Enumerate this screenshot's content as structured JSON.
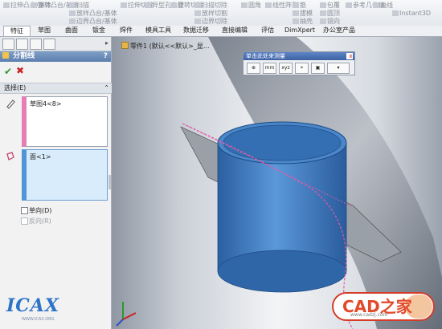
{
  "ribbon": {
    "items": [
      "拉伸凸台/基体",
      "旋转凸台/基体",
      "扫描",
      "放样凸台/基体",
      "边界凸台/基体",
      "拉伸切除",
      "异型孔向导",
      "旋转切除",
      "扫描切除",
      "放样切割",
      "边界切除",
      "圆角",
      "线性阵列",
      "筋",
      "拔模",
      "抽壳",
      "包覆",
      "圆顶",
      "镜向",
      "参考几何体",
      "曲线",
      "Instant3D"
    ]
  },
  "tabs": [
    "特征",
    "草图",
    "曲面",
    "钣金",
    "焊件",
    "模具工具",
    "数据迁移",
    "直接编辑",
    "评估",
    "DimXpert",
    "办公室产品"
  ],
  "panel": {
    "title": "分割线",
    "section_label": "选择(E)",
    "box1_item": "草图4<8>",
    "box2_item": "面<1>",
    "check1": "单向(D)",
    "check2": "反向(R)"
  },
  "viewport": {
    "part_label": "零件1  (默认<<默认>_显..."
  },
  "measure_toolbar": {
    "title": "单击此处来测量",
    "close": "x"
  },
  "logo": {
    "text": "ICAX",
    "sub": "WWW.ICAX.ORG"
  },
  "watermark": {
    "text": "CAD之家",
    "url": "www.cadzj.com"
  },
  "colors": {
    "accent": "#4f95d8",
    "pink": "#e67db4",
    "title_bar": "#5d7fae",
    "cylinder": "#3f7fc4"
  }
}
